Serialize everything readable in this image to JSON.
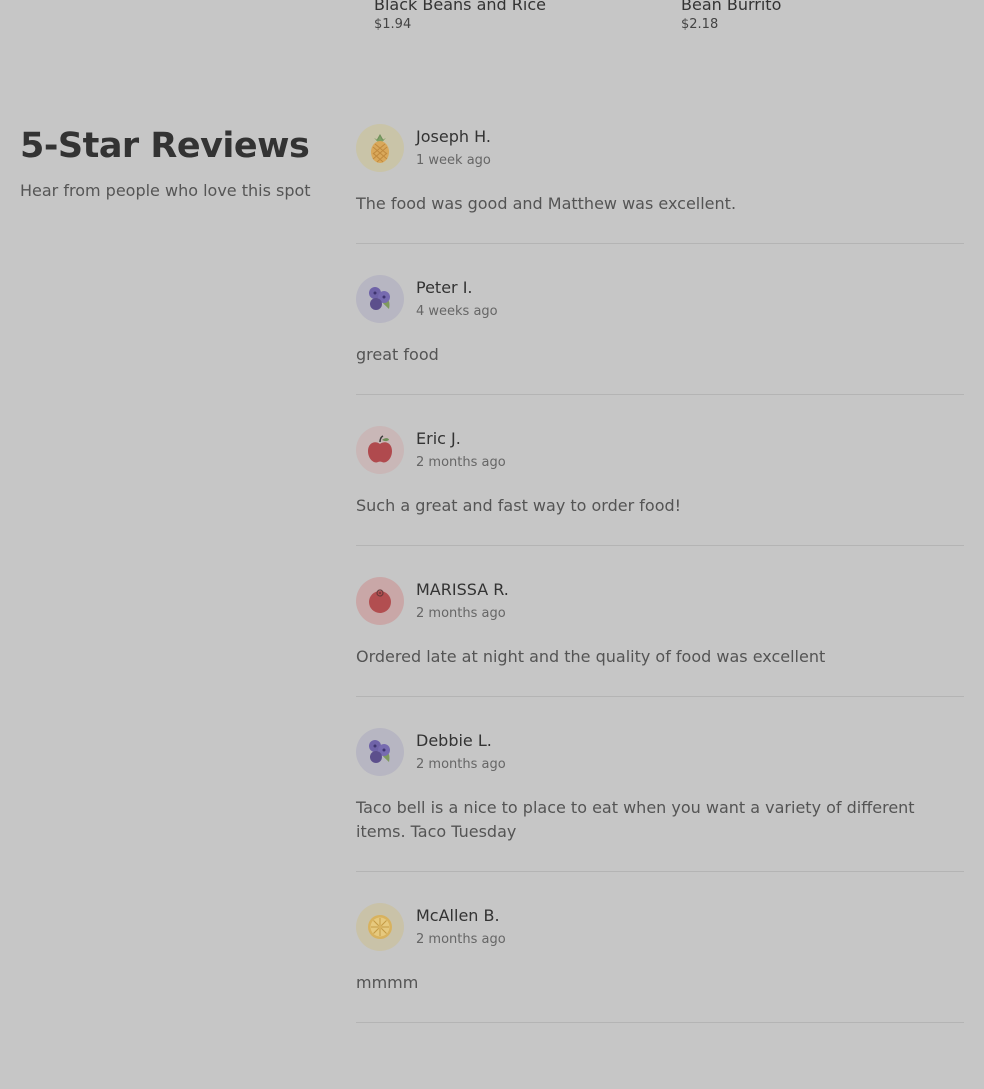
{
  "menu_items": [
    {
      "name": "Black Beans and Rice",
      "price": "$1.94"
    },
    {
      "name": "Bean Burrito",
      "price": "$2.18"
    }
  ],
  "reviews_section": {
    "title": "5-Star Reviews",
    "subtitle": "Hear from people who love this spot"
  },
  "reviews": [
    {
      "name": "Joseph H.",
      "date": "1 week ago",
      "text": "The food was good and Matthew was excellent.",
      "avatar_icon": "pineapple-icon",
      "avatar_bg": "#c9c4a8"
    },
    {
      "name": "Peter I.",
      "date": "4 weeks ago",
      "text": "great food",
      "avatar_icon": "blueberries-icon",
      "avatar_bg": "#b7b6c2"
    },
    {
      "name": "Eric J.",
      "date": "2 months ago",
      "text": "Such a great and fast way to order food!",
      "avatar_icon": "apple-icon",
      "avatar_bg": "#c9b7b7"
    },
    {
      "name": "MARISSA R.",
      "date": "2 months ago",
      "text": "Ordered late at night and the quality of food was excellent",
      "avatar_icon": "tomato-icon",
      "avatar_bg": "#c9a7a7"
    },
    {
      "name": "Debbie L.",
      "date": "2 months ago",
      "text": "Taco bell is a nice to place to eat when you want a variety of different items. Taco Tuesday",
      "avatar_icon": "blueberries-icon",
      "avatar_bg": "#b7b6c2"
    },
    {
      "name": "McAllen B.",
      "date": "2 months ago",
      "text": "mmmm",
      "avatar_icon": "lemon-slice-icon",
      "avatar_bg": "#c9c2a8"
    }
  ]
}
